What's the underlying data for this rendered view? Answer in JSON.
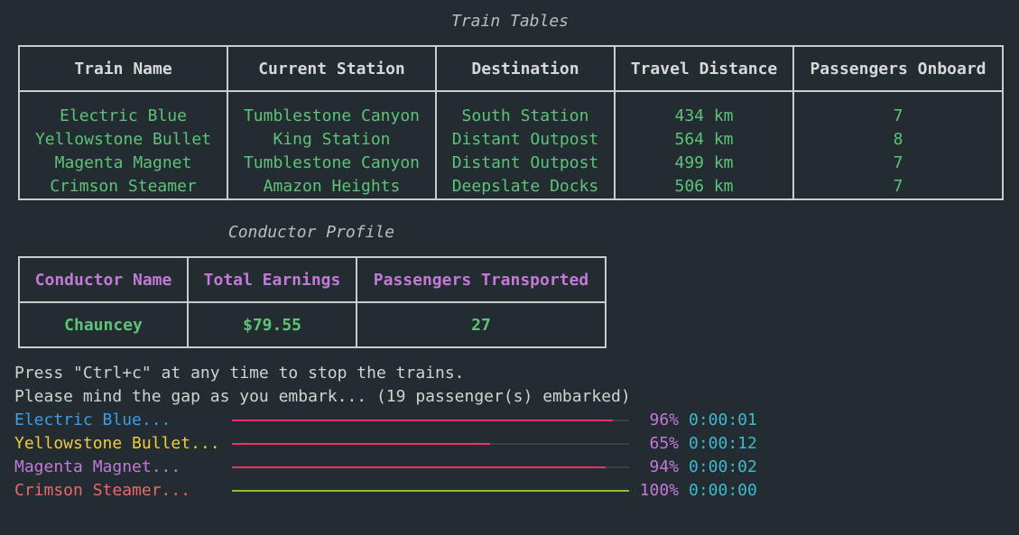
{
  "train_table": {
    "caption": "Train Tables",
    "headers": [
      "Train Name",
      "Current Station",
      "Destination",
      "Travel Distance",
      "Passengers Onboard"
    ],
    "rows": [
      [
        "Electric Blue",
        "Tumblestone Canyon",
        "South Station",
        "434 km",
        "7"
      ],
      [
        "Yellowstone Bullet",
        "King Station",
        "Distant Outpost",
        "564 km",
        "8"
      ],
      [
        "Magenta Magnet",
        "Tumblestone Canyon",
        "Distant Outpost",
        "499 km",
        "7"
      ],
      [
        "Crimson Steamer",
        "Amazon Heights",
        "Deepslate Docks",
        "506 km",
        "7"
      ]
    ]
  },
  "conductor_table": {
    "caption": "Conductor Profile",
    "headers": [
      "Conductor Name",
      "Total Earnings",
      "Passengers Transported"
    ],
    "row": [
      "Chauncey",
      "$79.55",
      "27"
    ]
  },
  "console": {
    "line1": "Press \"Ctrl+c\" at any time to stop the trains.",
    "line2": "Please mind the gap as you embark... (19 passenger(s) embarked)"
  },
  "progress": [
    {
      "name": "Electric Blue...",
      "name_color": "#3d9be9",
      "percent_value": 96,
      "percent": "96%",
      "elapsed": "0:00:01",
      "bar_color": "#f02e6e"
    },
    {
      "name": "Yellowstone Bullet...",
      "name_color": "#f2ca3d",
      "percent_value": 65,
      "percent": "65%",
      "elapsed": "0:00:12",
      "bar_color": "#f02e6e"
    },
    {
      "name": "Magenta Magnet...",
      "name_color": "#c478d8",
      "percent_value": 94,
      "percent": "94%",
      "elapsed": "0:00:02",
      "bar_color": "#f02e6e"
    },
    {
      "name": "Crimson Steamer...",
      "name_color": "#e8696a",
      "percent_value": 100,
      "percent": "100%",
      "elapsed": "0:00:00",
      "bar_color": "#8dc22c"
    }
  ]
}
